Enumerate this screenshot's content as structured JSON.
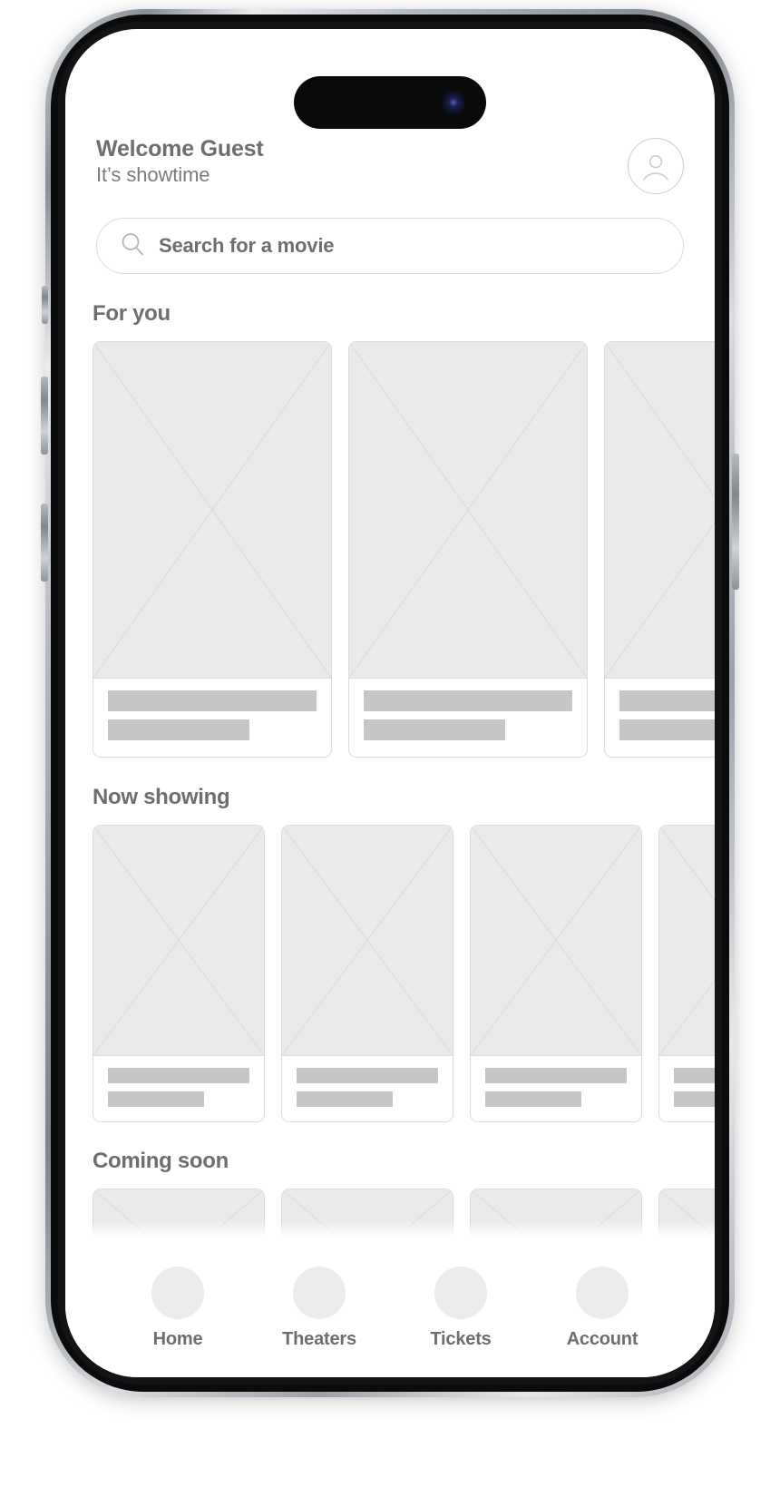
{
  "device": {
    "name": "smartphone-mockup",
    "island_label": "dynamic-island",
    "camera_label": "front-camera"
  },
  "header": {
    "title": "Welcome Guest",
    "subtitle": "It’s showtime",
    "avatar_icon": "account-circle-icon"
  },
  "search": {
    "icon": "search-icon",
    "value": "Search for a movie",
    "placeholder": "Search for a movie"
  },
  "sections": [
    {
      "id": "for-you",
      "title": "For you",
      "card_size": "large",
      "cards": [
        {
          "image": "placeholder-image",
          "line1_width": "100%",
          "line2_width": "68%"
        },
        {
          "image": "placeholder-image",
          "line1_width": "100%",
          "line2_width": "68%"
        },
        {
          "image": "placeholder-image",
          "line1_width": "100%",
          "line2_width": "68%"
        }
      ]
    },
    {
      "id": "now-showing",
      "title": "Now showing",
      "card_size": "medium",
      "cards": [
        {
          "image": "placeholder-image",
          "line1_width": "100%",
          "line2_width": "68%"
        },
        {
          "image": "placeholder-image",
          "line1_width": "100%",
          "line2_width": "68%"
        },
        {
          "image": "placeholder-image",
          "line1_width": "100%",
          "line2_width": "68%"
        },
        {
          "image": "placeholder-image",
          "line1_width": "100%",
          "line2_width": "68%"
        }
      ]
    },
    {
      "id": "coming-soon",
      "title": "Coming soon",
      "card_size": "small",
      "cards": [
        {
          "image": "placeholder-image",
          "line1_width": "100%",
          "line2_width": "68%"
        },
        {
          "image": "placeholder-image",
          "line1_width": "100%",
          "line2_width": "68%"
        },
        {
          "image": "placeholder-image",
          "line1_width": "100%",
          "line2_width": "68%"
        },
        {
          "image": "placeholder-image",
          "line1_width": "100%",
          "line2_width": "68%"
        }
      ]
    }
  ],
  "bottom_nav": {
    "items": [
      {
        "label": "Home",
        "icon": "home-icon",
        "active": true
      },
      {
        "label": "Theaters",
        "icon": "theaters-icon",
        "active": false
      },
      {
        "label": "Tickets",
        "icon": "tickets-icon",
        "active": false
      },
      {
        "label": "Account",
        "icon": "account-icon",
        "active": false
      }
    ]
  },
  "colors": {
    "text_gray": "#6e6e6e",
    "border_gray": "#dcdcdc",
    "placeholder_fill": "#eaeaea",
    "skeleton_fill": "#c6c6c6",
    "nav_icon_fill": "#ebebeb",
    "background": "#ffffff"
  }
}
